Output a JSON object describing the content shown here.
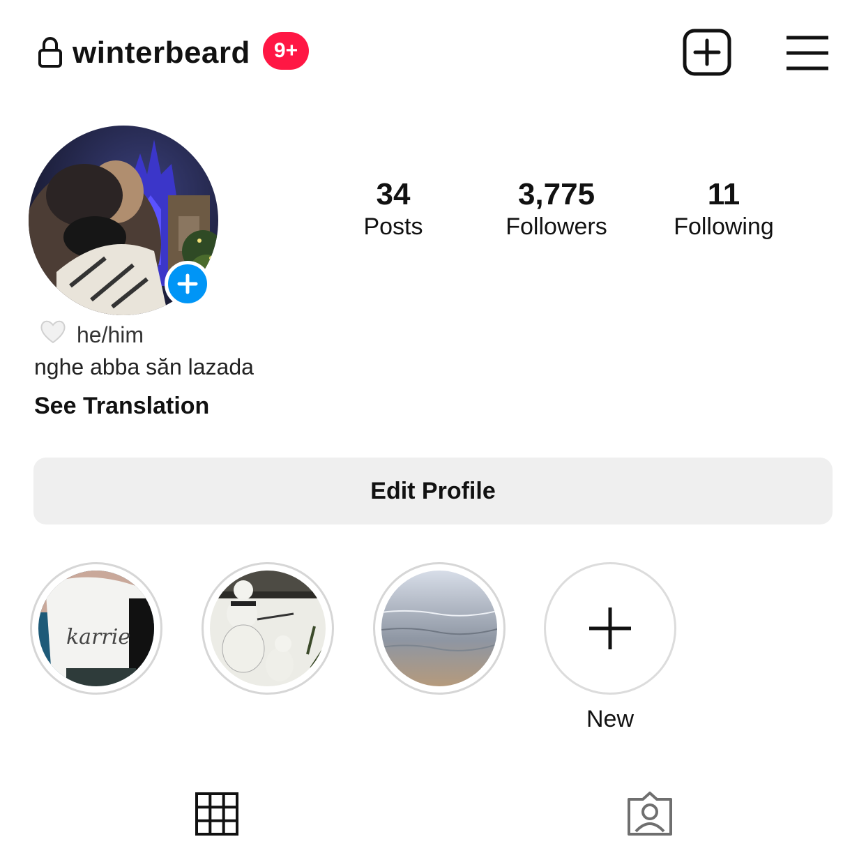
{
  "header": {
    "username": "winterbeard",
    "notification_badge": "9+",
    "badge_color": "#ff1744"
  },
  "profile": {
    "stats": [
      {
        "value": "34",
        "label": "Posts"
      },
      {
        "value": "3,775",
        "label": "Followers"
      },
      {
        "value": "11",
        "label": "Following"
      }
    ],
    "pronouns": "he/him",
    "bio": "nghe abba săn lazada",
    "see_translation": "See Translation",
    "edit_profile_label": "Edit Profile"
  },
  "highlights": {
    "new_label": "New"
  },
  "icons": [
    "lock-icon",
    "new-post-icon",
    "menu-icon",
    "add-story-icon",
    "white-heart-icon",
    "grid-icon",
    "tagged-icon"
  ],
  "colors": {
    "accent_blue": "#0095f6",
    "button_bg": "#efefef"
  }
}
